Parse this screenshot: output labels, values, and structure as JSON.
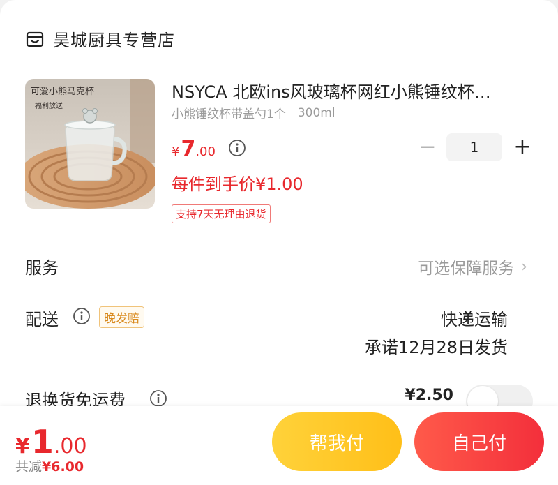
{
  "store": {
    "name": "昊城厨具专营店",
    "icon": "store-icon"
  },
  "product": {
    "title": "NSYCA 北欧ins风玻璃杯网红小熊锤纹杯…",
    "sku_spec": "小熊锤纹杯带盖勺1个",
    "sku_size": "300ml",
    "price_currency": "¥",
    "price_int": "7",
    "price_dec": ".00",
    "final_price": "每件到手价¥1.00",
    "return_badge": "支持7天无理由退货",
    "quantity": "1",
    "image_text": {
      "brand_line": "可爱小熊马克杯",
      "sub_line": "福利放送"
    }
  },
  "service": {
    "label": "服务",
    "value": "可选保障服务"
  },
  "shipping": {
    "label": "配送",
    "badge": "晚发赔",
    "method": "快递运输",
    "promise": "承诺12月28日发货"
  },
  "return_freight": {
    "label": "退换货免运费",
    "price": "¥2.50",
    "enabled": false
  },
  "footer": {
    "total_currency": "¥",
    "total_int": "1",
    "total_dec": ".00",
    "saved_label": "共减",
    "saved_amount": "¥6.00",
    "help_pay": "帮我付",
    "self_pay": "自己付"
  },
  "colors": {
    "accent_red": "#e8282d",
    "help_button": "#ffc726",
    "self_button": "#f5393d",
    "badge_orange": "#d98a1e"
  }
}
